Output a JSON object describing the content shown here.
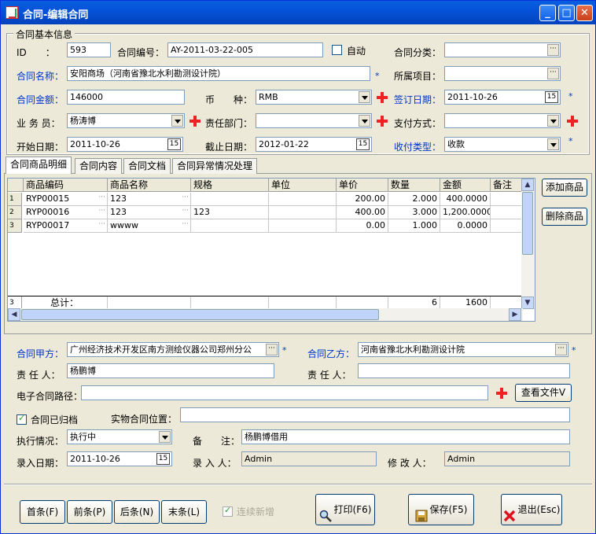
{
  "window": {
    "title": "合同-编辑合同"
  },
  "group_basic": {
    "title": "合同基本信息"
  },
  "fields": {
    "id_label": "ID　　：",
    "id_value": "593",
    "contract_no_label": "合同编号：",
    "contract_no_value": "AY-2011-03-22-005",
    "auto_label": "自动",
    "category_label": "合同分类：",
    "category_value": "",
    "contract_name_label": "合同名称：",
    "contract_name_value": "安阳商场（河南省豫北水利勘测设计院）",
    "project_label": "所属项目：",
    "project_value": "",
    "amount_label": "合同金额：",
    "amount_value": "146000",
    "currency_label": "币　　种：",
    "currency_value": "RMB",
    "sign_date_label": "签订日期：",
    "sign_date_value": "2011-10-26",
    "salesman_label": "业 务 员：",
    "salesman_value": "杨涛博",
    "dept_label": "责任部门：",
    "dept_value": "",
    "pay_method_label": "支付方式：",
    "pay_method_value": "",
    "start_date_label": "开始日期：",
    "start_date_value": "2011-10-26",
    "end_date_label": "截止日期：",
    "end_date_value": "2012-01-22",
    "pay_type_label": "收付类型：",
    "pay_type_value": "收款",
    "star": "*",
    "cal_icon": "15"
  },
  "tabs": [
    "合同商品明细",
    "合同内容",
    "合同文档",
    "合同异常情况处理"
  ],
  "grid": {
    "columns": [
      "商品编码",
      "商品名称",
      "规格",
      "单位",
      "单价",
      "数量",
      "金额",
      "备注"
    ],
    "rows": [
      {
        "no": "1",
        "code": "RYP00015",
        "name": "123",
        "spec": "",
        "unit": "",
        "price": "200.00",
        "qty": "2.000",
        "amount": "400.0000",
        "note": ""
      },
      {
        "no": "2",
        "code": "RYP00016",
        "name": "123",
        "spec": "123",
        "unit": "",
        "price": "400.00",
        "qty": "3.000",
        "amount": "1,200.0000",
        "note": ""
      },
      {
        "no": "3",
        "code": "RYP00017",
        "name": "wwww",
        "spec": "",
        "unit": "",
        "price": "0.00",
        "qty": "1.000",
        "amount": "0.0000",
        "note": ""
      }
    ],
    "total": {
      "count": "3",
      "label": "总计：",
      "qty": "6",
      "amount": "1600"
    }
  },
  "side_buttons": {
    "add": "添加商品",
    "delete": "删除商品"
  },
  "lower": {
    "party_a_label": "合同甲方：",
    "party_a_value": "广州经济技术开发区南方测绘仪器公司郑州分公",
    "party_b_label": "合同乙方：",
    "party_b_value": "河南省豫北水利勘测设计院",
    "resp_a_label": "责 任 人：",
    "resp_a_value": "杨鹏博",
    "resp_b_label": "责 任 人：",
    "resp_b_value": "",
    "epath_label": "电子合同路径：",
    "epath_value": "",
    "view_file": "查看文件V",
    "archived_label": "合同已归档",
    "physical_label": "实物合同位置：",
    "physical_value": "",
    "exec_label": "执行情况：",
    "exec_value": "执行中",
    "remark_label": "备　　注：",
    "remark_value": "杨鹏博借用",
    "entry_date_label": "录入日期：",
    "entry_date_value": "2011-10-26",
    "entry_person_label": "录 入 人：",
    "entry_person_value": "Admin",
    "modifier_label": "修 改 人：",
    "modifier_value": "Admin"
  },
  "footer": {
    "first": "首条(F)",
    "prev": "前条(P)",
    "next": "后条(N)",
    "last": "末条(L)",
    "continuous": "连续新增",
    "print": "打印(F6)",
    "save": "保存(F5)",
    "exit": "退出(Esc)"
  },
  "colors": {
    "titlebar": "#0453d8",
    "label_blue": "#0033cc",
    "plus_red": "#e22222"
  }
}
